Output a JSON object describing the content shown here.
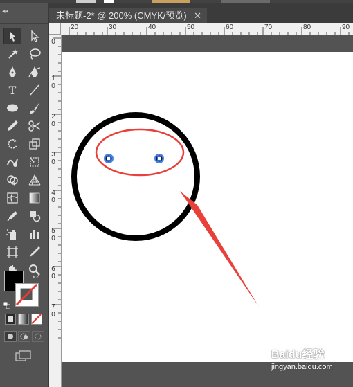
{
  "document_tab": {
    "title": "未标题-2* @ 200% (CMYK/预览)",
    "close_glyph": "✕"
  },
  "toolbox": {
    "collapse_glyph": "◂◂",
    "tools": [
      "selection-tool",
      "direct-selection-tool",
      "magic-wand-tool",
      "lasso-tool",
      "pen-tool",
      "curvature-tool",
      "type-tool",
      "line-segment-tool",
      "ellipse-tool",
      "paintbrush-tool",
      "pencil-tool",
      "scissors-tool",
      "rotate-tool",
      "scale-tool",
      "warp-tool",
      "free-transform-tool",
      "shape-builder-tool",
      "perspective-grid-tool",
      "mesh-tool",
      "gradient-tool",
      "eyedropper-tool",
      "blend-tool",
      "symbol-sprayer-tool",
      "column-graph-tool",
      "artboard-tool",
      "slice-tool",
      "hand-tool",
      "zoom-tool"
    ],
    "fill_color": "#000000",
    "stroke_color": "none"
  },
  "rulers": {
    "horizontal_labels": [
      "20",
      "30",
      "40",
      "50",
      "60",
      "70",
      "80",
      "90"
    ],
    "vertical_labels": [
      "0",
      "1\n0",
      "2\n0",
      "3\n0",
      "4\n0",
      "5\n0",
      "6\n0",
      "7\n0"
    ]
  },
  "colors": {
    "face_stroke": "#000000",
    "annotation_red": "#e8413b",
    "anchor_blue": "#2d6cd8"
  },
  "watermark": {
    "brand": "Baidu经验",
    "url": "jingyan.baidu.com"
  }
}
